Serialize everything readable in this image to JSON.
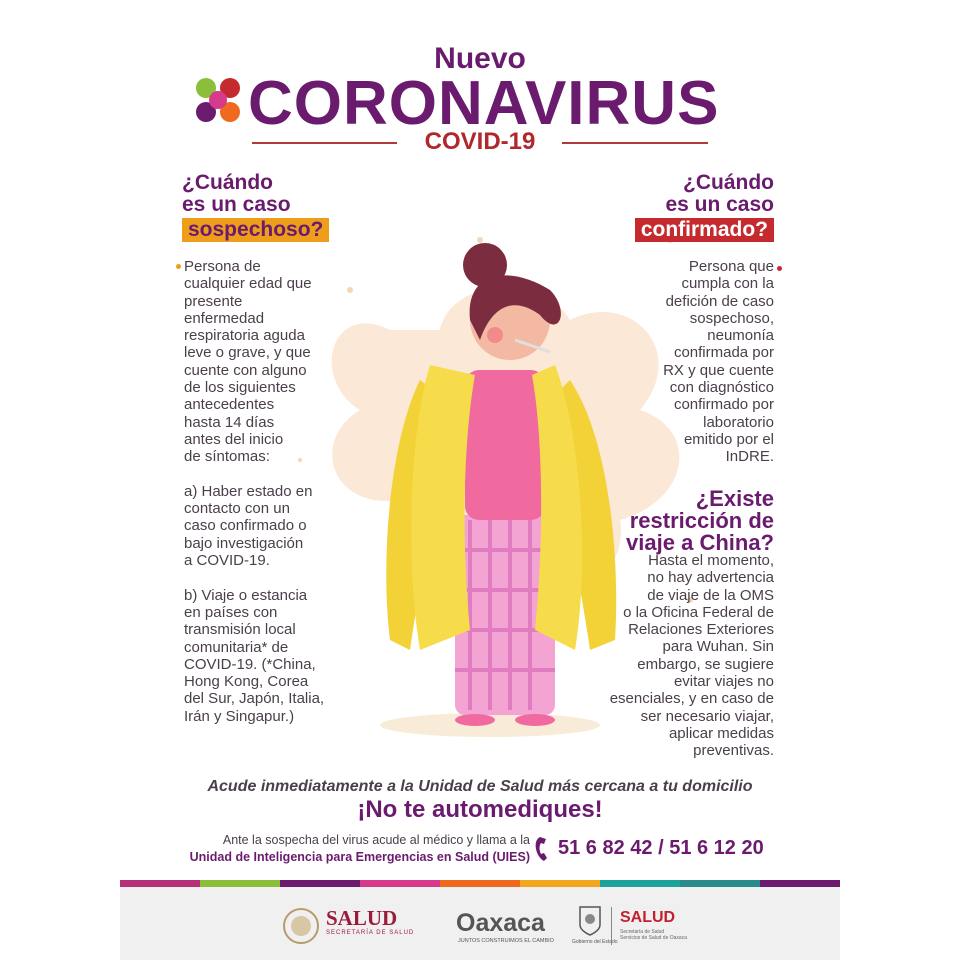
{
  "header": {
    "nuevo": "Nuevo",
    "title": "CORONAVIRUS",
    "subtitle": "COVID-19"
  },
  "sospechoso": {
    "heading_line1": "¿Cuándo",
    "heading_line2": "es un caso",
    "tag": "sospechoso?",
    "text_lines": [
      "Persona de",
      "cualquier edad que",
      "presente",
      "enfermedad",
      "respiratoria aguda",
      "leve o grave, y que",
      "cuente con alguno",
      "de los siguientes",
      "antecedentes",
      "hasta 14 días",
      "antes del inicio",
      "de síntomas:",
      "",
      "a) Haber estado en",
      "contacto con un",
      "caso confirmado o",
      "bajo investigación",
      "a COVID-19.",
      "",
      "b) Viaje o estancia",
      "en países con",
      "transmisión local",
      "comunitaria* de",
      "COVID-19. (*China,",
      "Hong Kong, Corea",
      "del Sur, Japón, Italia,",
      "Irán y Singapur.)"
    ]
  },
  "confirmado": {
    "heading_line1": "¿Cuándo",
    "heading_line2": "es un caso",
    "tag": "confirmado?",
    "text_lines": [
      "Persona que",
      "cumpla con la",
      "defición de caso",
      "sospechoso,",
      "neumonía",
      "confirmada por",
      "RX y que cuente",
      "con diagnóstico",
      "confirmado por",
      "laboratorio",
      "emitido por el",
      "InDRE."
    ]
  },
  "viaje": {
    "heading_lines": [
      "¿Existe",
      "restricción de",
      "viaje a China?"
    ],
    "text_lines": [
      "Hasta el momento,",
      "no hay advertencia",
      "de viaje de la OMS",
      "o la Oficina Federal de",
      "Relaciones Exteriores",
      "para Wuhan. Sin",
      "embargo, se sugiere",
      "evitar viajes no",
      "esenciales, y en caso de",
      "ser necesario viajar,",
      "aplicar medidas",
      "preventivas."
    ]
  },
  "cta": "Acude inmediatamente a la Unidad de Salud más cercana a tu domicilio",
  "slogan": "¡No te automediques!",
  "contact": {
    "line1": "Ante la sospecha del virus acude al médico y llama a la",
    "line2": "Unidad de Inteligencia para Emergencias en Salud (UIES)",
    "phone": "51 6 82 42 / 51 6 12 20",
    "phone_icon": "phone-icon"
  },
  "footer": {
    "salud": "SALUD",
    "salud_sub": "SECRETARÍA DE SALUD",
    "oaxaca": "Oaxaca",
    "oaxaca_sub": "JUNTOS CONSTRUIMOS EL CAMBIO",
    "crest_caption": "Gobierno del Estado",
    "salud_right": "SALUD",
    "salud_right_sub1": "Secretaría de Salud",
    "salud_right_sub2": "Servicios de Salud de Oaxaca"
  },
  "colors": {
    "purple": "#6a1b6e",
    "red": "#c52a2e",
    "orange": "#ef9e1b",
    "bar": [
      "#b5327b",
      "#8bbf3a",
      "#6a1b6e",
      "#d63a8a",
      "#ef6a1e",
      "#f1a81e",
      "#1aa39a",
      "#2a8b8b",
      "#6a1b6e"
    ]
  }
}
